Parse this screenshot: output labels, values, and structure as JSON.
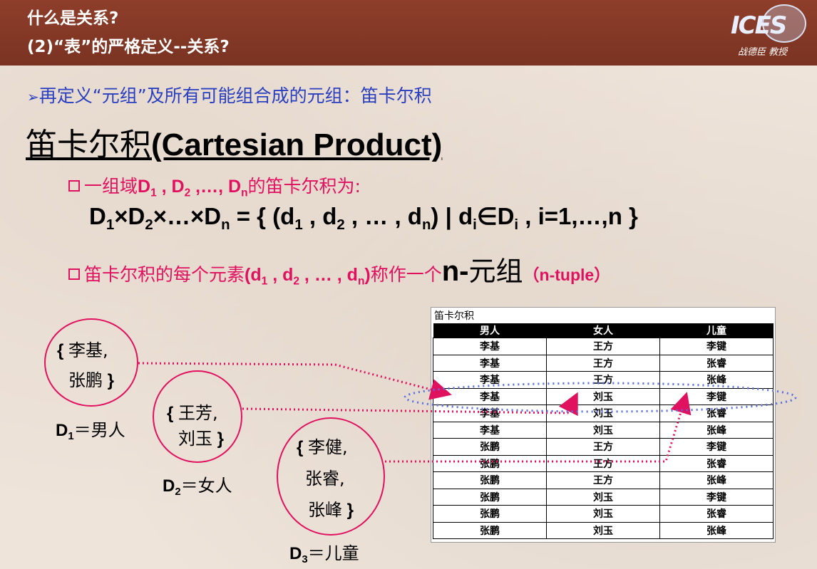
{
  "header": {
    "title_line1": "什么是关系?",
    "title_line2": "(2)“表”的严格定义--关系?",
    "logo_text": "ICES",
    "logo_subtitle": "战德臣 教授"
  },
  "bullet1": "再定义“元组”及所有可能组合成的元组：笛卡尔积",
  "heading": {
    "chinese": "笛卡尔积",
    "english": "(Cartesian Product)"
  },
  "definition": {
    "line_prefix": "一组域",
    "line_suffix": "的笛卡尔积为:",
    "tuple_prefix": "笛卡尔积的每个元素",
    "tuple_mid": "称作一个",
    "tuple_big": "n-",
    "tuple_big2": "元组",
    "tuple_paren": "（n-tuple）"
  },
  "sets": {
    "d1": {
      "items": [
        "李基,",
        "张鹏"
      ],
      "label_suffix": "＝男人"
    },
    "d2": {
      "items": [
        "王芳,",
        "刘玉"
      ],
      "label_suffix": "＝女人"
    },
    "d3": {
      "items": [
        "李健,",
        "张睿,",
        "张峰"
      ],
      "label_suffix": "＝儿童"
    }
  },
  "table": {
    "caption": "笛卡尔积",
    "headers": [
      "男人",
      "女人",
      "儿童"
    ],
    "rows": [
      [
        "李基",
        "王方",
        "李键"
      ],
      [
        "李基",
        "王方",
        "张睿"
      ],
      [
        "李基",
        "王方",
        "张峰"
      ],
      [
        "李基",
        "刘玉",
        "李键"
      ],
      [
        "李基",
        "刘玉",
        "张睿"
      ],
      [
        "李基",
        "刘玉",
        "张峰"
      ],
      [
        "张鹏",
        "王方",
        "李键"
      ],
      [
        "张鹏",
        "王方",
        "张睿"
      ],
      [
        "张鹏",
        "王方",
        "张峰"
      ],
      [
        "张鹏",
        "刘玉",
        "李键"
      ],
      [
        "张鹏",
        "刘玉",
        "张睿"
      ],
      [
        "张鹏",
        "刘玉",
        "张峰"
      ]
    ]
  },
  "colors": {
    "header_bg": "#8e3e2a",
    "bullet_blue": "#2a3fbf",
    "accent_pink": "#e0115f",
    "ellipse_blue": "#5a6ee6"
  }
}
